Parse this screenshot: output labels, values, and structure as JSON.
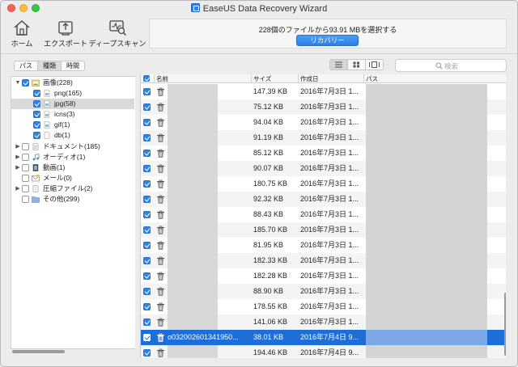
{
  "window": {
    "title": "EaseUS Data Recovery Wizard"
  },
  "toolbar": {
    "home_label": "ホーム",
    "export_label": "エクスポート",
    "deep_scan_label": "ディープスキャン",
    "status_text": "228個のファイルから93.91 MBを選択する",
    "recover_label": "リカバリー"
  },
  "sidebar": {
    "tabs": [
      {
        "label": "パス",
        "active": false
      },
      {
        "label": "種類",
        "active": true
      },
      {
        "label": "時間",
        "active": false
      }
    ],
    "tree": [
      {
        "label": "画像(228)",
        "checked": true,
        "expanded": true,
        "level": 0,
        "icon": "image-folder-icon"
      },
      {
        "label": "png(165)",
        "checked": true,
        "level": 1,
        "icon": "file-icon"
      },
      {
        "label": "jpg(58)",
        "checked": true,
        "level": 1,
        "icon": "file-icon",
        "selected": true
      },
      {
        "label": "icns(3)",
        "checked": true,
        "level": 1,
        "icon": "file-icon"
      },
      {
        "label": "gif(1)",
        "checked": true,
        "level": 1,
        "icon": "file-icon"
      },
      {
        "label": "db(1)",
        "checked": true,
        "level": 1,
        "icon": "file-icon"
      },
      {
        "label": "ドキュメント(185)",
        "checked": false,
        "expanded": false,
        "level": 0,
        "icon": "document-icon"
      },
      {
        "label": "オーディオ(1)",
        "checked": false,
        "expanded": false,
        "level": 0,
        "icon": "audio-icon"
      },
      {
        "label": "動画(1)",
        "checked": false,
        "expanded": false,
        "level": 0,
        "icon": "video-icon"
      },
      {
        "label": "メール(0)",
        "checked": false,
        "level": 0,
        "icon": "mail-icon"
      },
      {
        "label": "圧縮ファイル(2)",
        "checked": false,
        "expanded": false,
        "level": 0,
        "icon": "archive-icon"
      },
      {
        "label": "その他(299)",
        "checked": false,
        "level": 0,
        "icon": "folder-icon"
      }
    ]
  },
  "search": {
    "placeholder": "検索"
  },
  "table": {
    "headers": {
      "name": "名前",
      "size": "サイズ",
      "created": "作成日",
      "path": "パス"
    },
    "rows": [
      {
        "name": "",
        "size": "147.39 KB",
        "created": "2016年7月3日 1..."
      },
      {
        "name": "",
        "size": "75.12 KB",
        "created": "2016年7月3日 1..."
      },
      {
        "name": "",
        "size": "94.04 KB",
        "created": "2016年7月3日 1..."
      },
      {
        "name": "",
        "size": "91.19 KB",
        "created": "2016年7月3日 1..."
      },
      {
        "name": "",
        "size": "85.12 KB",
        "created": "2016年7月3日 1..."
      },
      {
        "name": "",
        "size": "90.07 KB",
        "created": "2016年7月3日 1..."
      },
      {
        "name": "",
        "size": "180.75 KB",
        "created": "2016年7月3日 1..."
      },
      {
        "name": "",
        "size": "92.32 KB",
        "created": "2016年7月3日 1..."
      },
      {
        "name": "",
        "size": "88.43 KB",
        "created": "2016年7月3日 1..."
      },
      {
        "name": "",
        "size": "185.70 KB",
        "created": "2016年7月3日 1..."
      },
      {
        "name": "",
        "size": "81.95 KB",
        "created": "2016年7月3日 1..."
      },
      {
        "name": "",
        "size": "182.33 KB",
        "created": "2016年7月3日 1..."
      },
      {
        "name": "",
        "size": "182.28 KB",
        "created": "2016年7月3日 1..."
      },
      {
        "name": "",
        "size": "88.90 KB",
        "created": "2016年7月3日 1..."
      },
      {
        "name": "",
        "size": "178.55 KB",
        "created": "2016年7月3日 1..."
      },
      {
        "name": "",
        "size": "141.06 KB",
        "created": "2016年7月3日 1..."
      },
      {
        "name": "o032002601341950...",
        "size": "38.01 KB",
        "created": "2016年7月4日 9...",
        "selected": true
      },
      {
        "name": "",
        "size": "194.46 KB",
        "created": "2016年7月4日 9..."
      }
    ]
  },
  "colors": {
    "accent": "#1e6ed8",
    "checkbox": "#2f84ec",
    "recover_button": "#2f7de0"
  }
}
